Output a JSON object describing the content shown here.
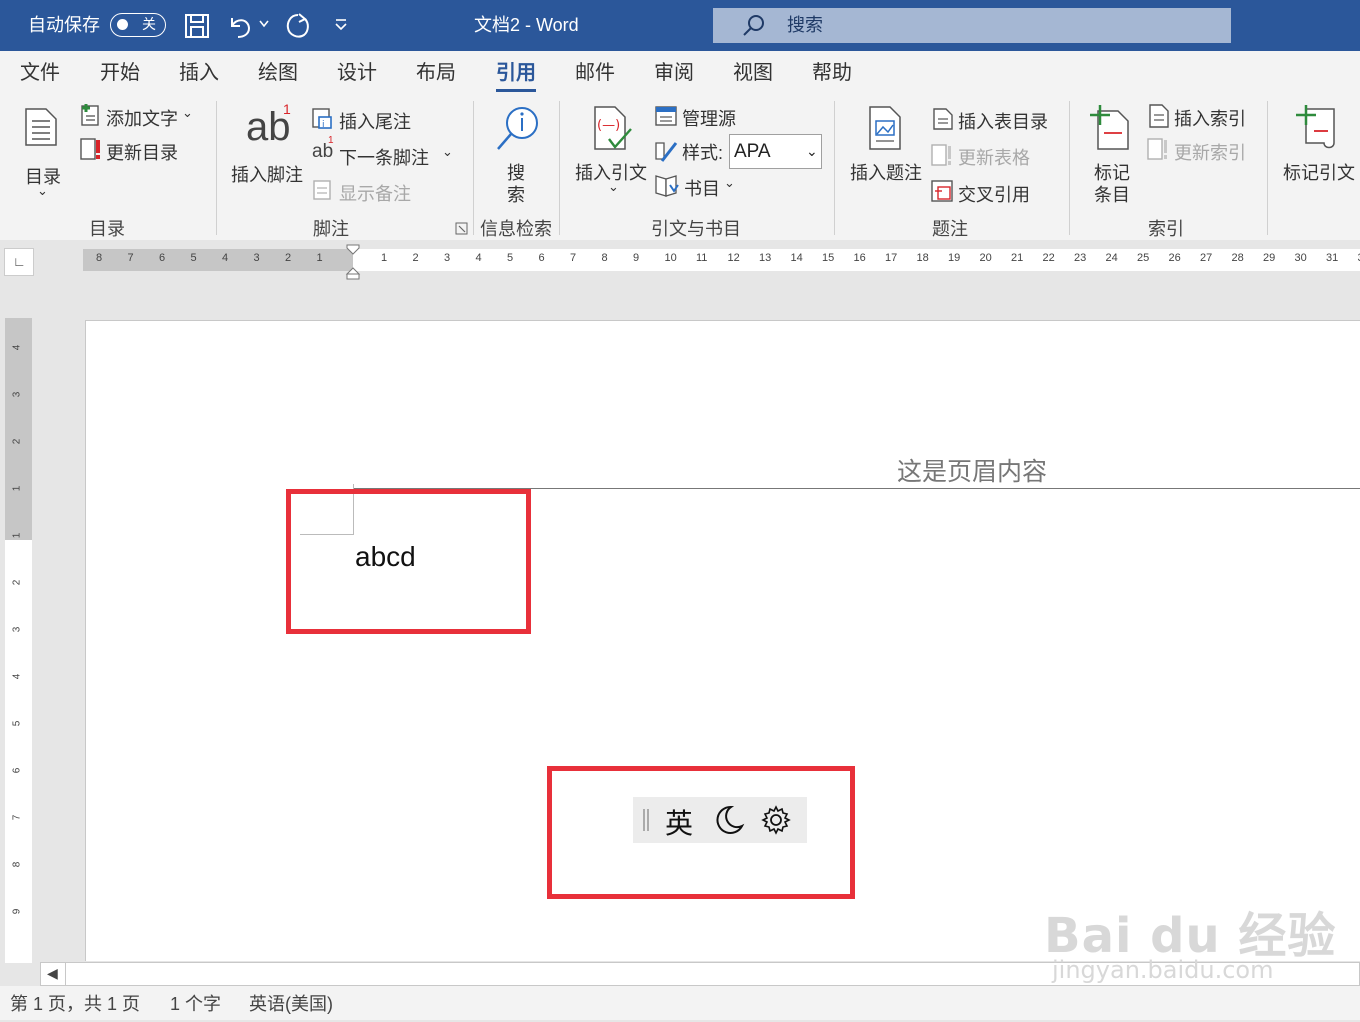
{
  "titlebar": {
    "autosave_label": "自动保存",
    "autosave_state": "关",
    "doc_title": "文档2  -  Word",
    "search_label": "搜索",
    "bg_color": "#2b579a"
  },
  "tabs": [
    "文件",
    "开始",
    "插入",
    "绘图",
    "设计",
    "布局",
    "引用",
    "邮件",
    "审阅",
    "视图",
    "帮助"
  ],
  "active_tab": "引用",
  "ribbon": {
    "toc": {
      "big_label": "目录",
      "add_text": "添加文字",
      "update_toc": "更新目录",
      "group": "目录"
    },
    "footnotes": {
      "big_label": "插入脚注",
      "insert_endnote": "插入尾注",
      "next_footnote": "下一条脚注",
      "show_notes": "显示备注",
      "group": "脚注"
    },
    "research": {
      "big_label_1": "搜",
      "big_label_2": "索",
      "group": "信息检索"
    },
    "citations": {
      "big_label": "插入引文",
      "manage_sources": "管理源",
      "style_label": "样式:",
      "style_value": "APA",
      "bibliography": "书目",
      "group": "引文与书目"
    },
    "captions": {
      "big_label": "插入题注",
      "insert_table_of_figures": "插入表目录",
      "update_table": "更新表格",
      "cross_reference": "交叉引用",
      "group": "题注"
    },
    "index": {
      "big_label_1": "标记",
      "big_label_2": "条目",
      "insert_index": "插入索引",
      "update_index": "更新索引",
      "group": "索引"
    },
    "authorities": {
      "big_label": "标记引文"
    }
  },
  "ruler": {
    "left_numbers": [
      "8",
      "7",
      "6",
      "5",
      "4",
      "3",
      "2",
      "1"
    ],
    "right_numbers": [
      "1",
      "2",
      "3",
      "4",
      "5",
      "6",
      "7",
      "8",
      "9",
      "10",
      "11",
      "12",
      "13",
      "14",
      "15",
      "16",
      "17",
      "18",
      "19",
      "20",
      "21",
      "22",
      "23",
      "24",
      "25",
      "26",
      "27",
      "28",
      "29",
      "30",
      "31",
      "3"
    ],
    "vertical_numbers": [
      "4",
      "3",
      "2",
      "1",
      "1",
      "2",
      "3",
      "4",
      "5",
      "6",
      "7",
      "8",
      "9"
    ]
  },
  "document": {
    "header_text": "这是页眉内容",
    "body_text": "abcd",
    "highlight_color": "#e8303a"
  },
  "ime_bar": {
    "mode": "英"
  },
  "statusbar": {
    "page": "第 1 页，共 1 页",
    "words": "1 个字",
    "language": "英语(美国)"
  },
  "watermark": {
    "brand": "Bai du 经验",
    "url": "jingyan.baidu.com"
  }
}
